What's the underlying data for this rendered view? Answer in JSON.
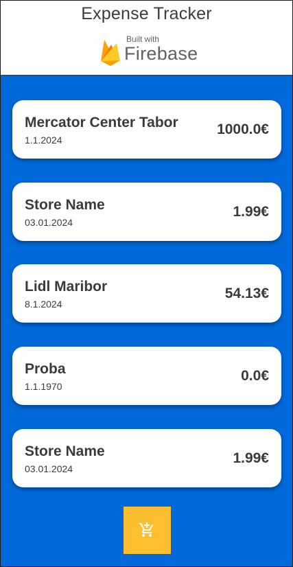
{
  "header": {
    "title": "Expense Tracker",
    "badge_small": "Built with",
    "badge_brand": "Firebase"
  },
  "expenses": [
    {
      "store": "Mercator Center Tabor",
      "date": "1.1.2024",
      "amount": "1000.0€"
    },
    {
      "store": "Store Name",
      "date": "03.01.2024",
      "amount": "1.99€"
    },
    {
      "store": "Lidl Maribor",
      "date": "8.1.2024",
      "amount": "54.13€"
    },
    {
      "store": "Proba",
      "date": "1.1.1970",
      "amount": "0.0€"
    },
    {
      "store": "Store Name",
      "date": "03.01.2024",
      "amount": "1.99€"
    }
  ],
  "fab": {
    "icon": "add-shopping-cart-icon"
  },
  "colors": {
    "background": "#0169d9",
    "fab": "#fbbf2f",
    "card": "#ffffff",
    "text": "#3a3a3a"
  }
}
